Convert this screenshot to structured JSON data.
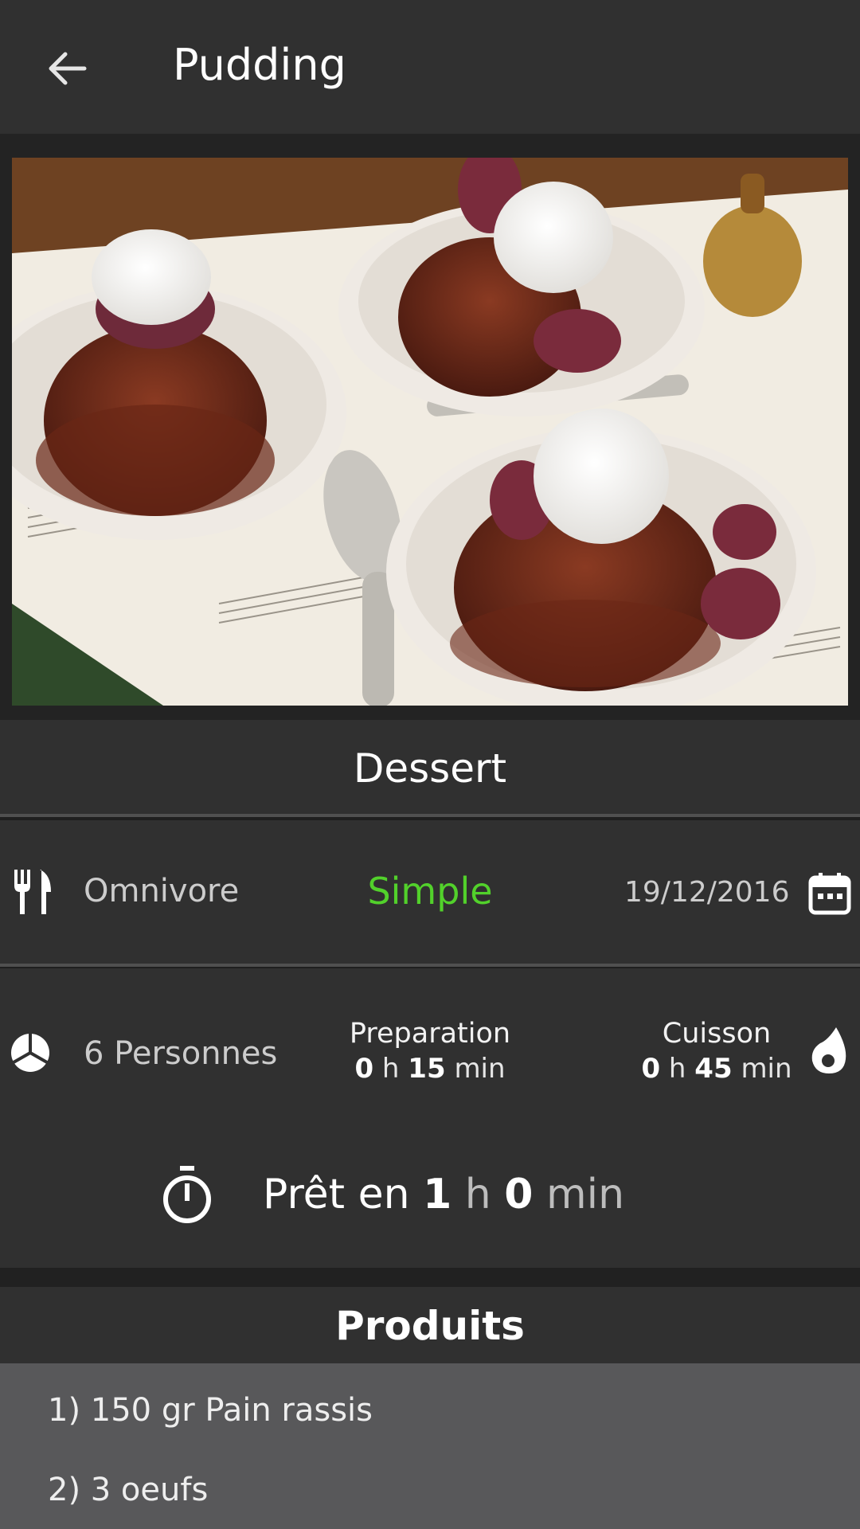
{
  "appbar": {
    "title": "Pudding",
    "back_icon": "arrow-back-icon"
  },
  "hero": {
    "image_icon": "pudding-dessert-photo"
  },
  "category": {
    "label": "Dessert"
  },
  "info": {
    "diet": "Omnivore",
    "difficulty": "Simple",
    "difficulty_color": "#52d12b",
    "date": "19/12/2016",
    "servings": "6 Personnes",
    "prep_label": "Preparation",
    "prep_h": "0",
    "prep_min": "15",
    "cook_label": "Cuisson",
    "cook_h": "0",
    "cook_min": "45",
    "unit_h": "h",
    "unit_min": "min",
    "ready_prefix": "Prêt en",
    "ready_h": "1",
    "ready_min": "0"
  },
  "produits": {
    "title": "Produits",
    "items": [
      "1) 150 gr Pain rassis",
      "2) 3 oeufs"
    ]
  }
}
